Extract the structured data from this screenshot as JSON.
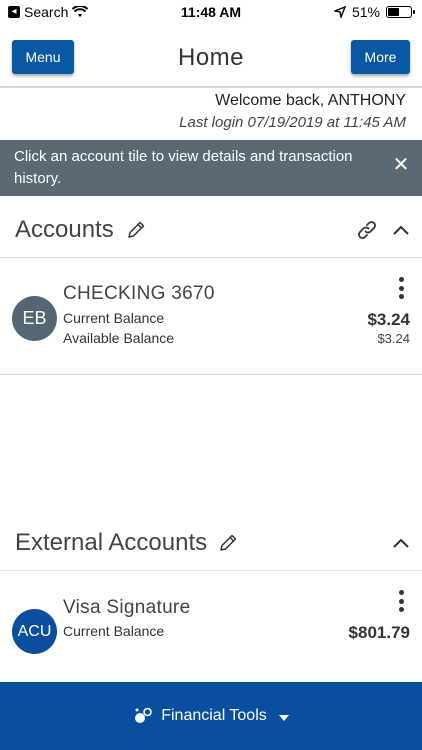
{
  "status_bar": {
    "back_app": "Search",
    "time": "11:48 AM",
    "battery_pct": "51%",
    "battery_level": 0.51
  },
  "header": {
    "menu_label": "Menu",
    "title": "Home",
    "more_label": "More"
  },
  "welcome": {
    "greeting": "Welcome back, ANTHONY",
    "last_login": "Last login 07/19/2019 at 11:45 AM"
  },
  "banner": {
    "message": "Click an account tile to view details and transaction history.",
    "close_icon": "close-icon"
  },
  "accounts_section": {
    "title": "Accounts",
    "tiles": [
      {
        "initials": "EB",
        "avatar_color": "#546674",
        "name": "CHECKING 3670",
        "label_1": "Current Balance",
        "label_2": "Available Balance",
        "current_balance": "$3.24",
        "available_balance": "$3.24"
      }
    ]
  },
  "external_section": {
    "title": "External Accounts",
    "tiles": [
      {
        "initials": "ACU",
        "avatar_color": "#0a4ea0",
        "name": "Visa Signature",
        "label_1": "Current Balance",
        "current_balance": "$801.79"
      }
    ]
  },
  "footer": {
    "label": "Financial Tools",
    "color": "#0a4ea0"
  },
  "colors": {
    "primary_button": "#0a57a3",
    "banner_bg": "#5a6974"
  }
}
